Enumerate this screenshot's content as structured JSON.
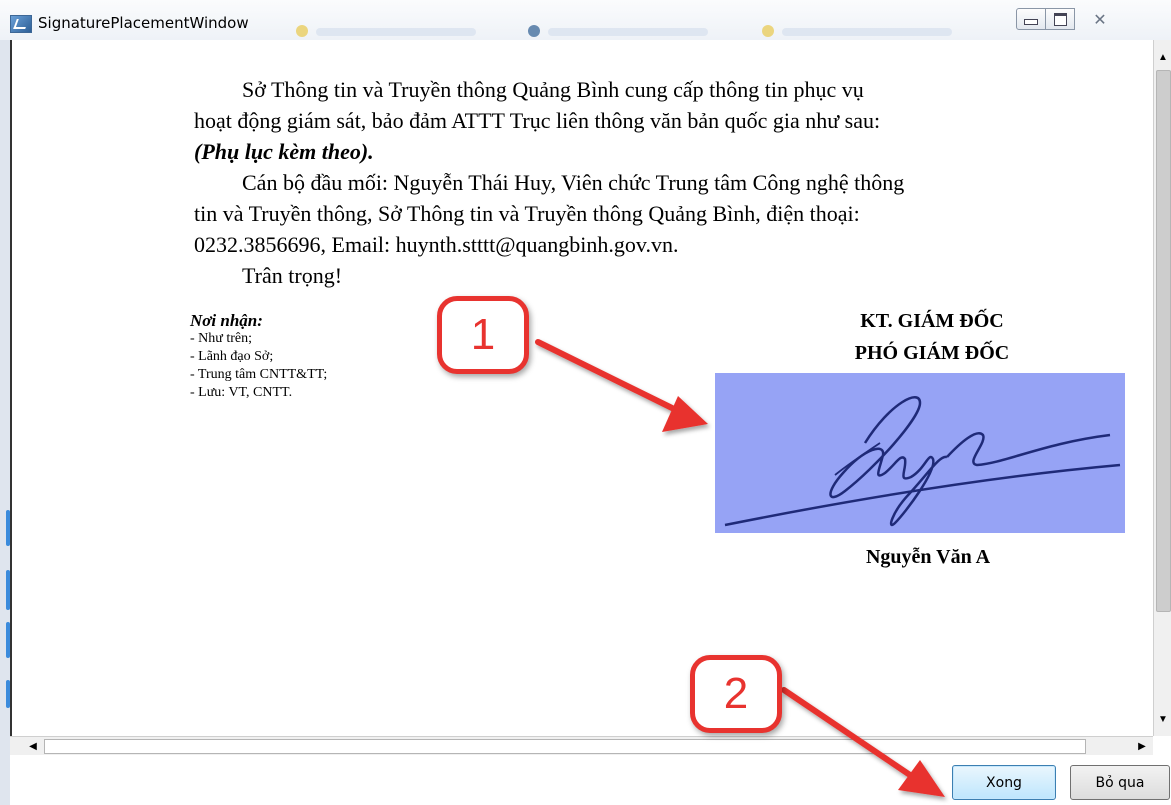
{
  "window": {
    "title": "SignaturePlacementWindow",
    "controls": {
      "minimize": "minimize",
      "maximize": "maximize",
      "close": "✕"
    }
  },
  "document": {
    "paragraph1": [
      "Sở Thông tin và Truyền thông  Quảng Bình cung cấp thông tin phục vụ",
      "hoạt động giám sát, bảo đảm ATTT Trục liên thông văn bản quốc gia như sau:",
      "(Phụ lục kèm theo)."
    ],
    "paragraph2": [
      "Cán bộ đầu mối: Nguyễn Thái Huy, Viên chức Trung tâm Công nghệ thông",
      "tin và Truyền thông, Sở Thông tin và Truyền thông Quảng Bình, điện thoại:",
      "0232.3856696,  Email: huynth.stttt@quangbinh.gov.vn."
    ],
    "closing": "Trân trọng!",
    "recipients": {
      "header": "Nơi nhận:",
      "items": [
        "- Như trên;",
        "- Lãnh đạo Sở;",
        "- Trung tâm CNTT&TT;",
        "- Lưu: VT, CNTT."
      ]
    },
    "signature": {
      "title_line1": "KT. GIÁM ĐỐC",
      "title_line2": "PHÓ GIÁM ĐỐC",
      "signer_name": "Nguyễn Văn A",
      "box_color": "#96a3f5"
    }
  },
  "callouts": {
    "first": "1",
    "second": "2",
    "color": "#e8332f"
  },
  "footer": {
    "done_label": "Xong",
    "skip_label": "Bỏ qua"
  }
}
